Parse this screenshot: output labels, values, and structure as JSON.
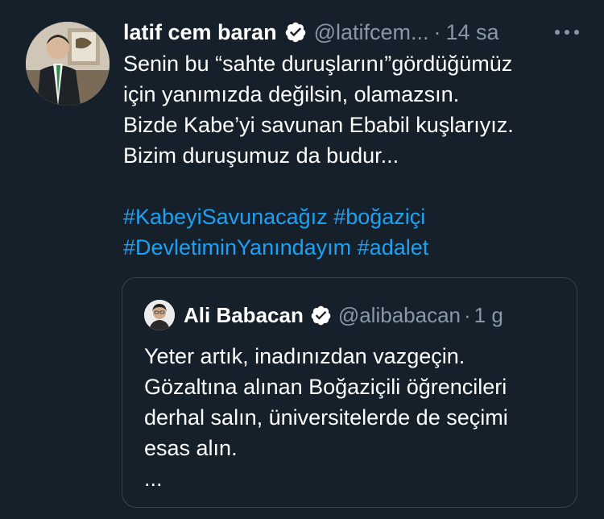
{
  "tweet": {
    "display_name": "latif cem baran",
    "handle": "@latifcem...",
    "separator": "·",
    "time": "14 sa",
    "more_icon": "more-horizontal-icon",
    "verified_icon": "verified-badge-icon",
    "body_lines": [
      "Senin bu “sahte duruşlarını”gördüğümüz",
      "için yanımızda değilsin, olamazsın.",
      "Bizde Kabe’yi savunan Ebabil kuşlarıyız.",
      "Bizim duruşumuz da budur..."
    ],
    "hashtag_lines": [
      [
        "#KabeyiSavunacağız",
        "#boğaziçi"
      ],
      [
        "#DevletiminYanındayım",
        "#adalet"
      ]
    ]
  },
  "quoted_tweet": {
    "display_name": "Ali Babacan",
    "handle": "@alibabacan",
    "separator": "·",
    "time": "1 g",
    "verified_icon": "verified-badge-icon",
    "body_lines": [
      "Yeter artık, inadınızdan vazgeçin.",
      "Gözaltına alınan Boğaziçili öğrencileri",
      "derhal salın, üniversitelerde de seçimi",
      "esas alın.",
      "..."
    ]
  },
  "colors": {
    "background": "#15202b",
    "text_primary": "#ffffff",
    "text_secondary": "#8899a6",
    "link": "#1da1f2",
    "border": "#38444d"
  }
}
